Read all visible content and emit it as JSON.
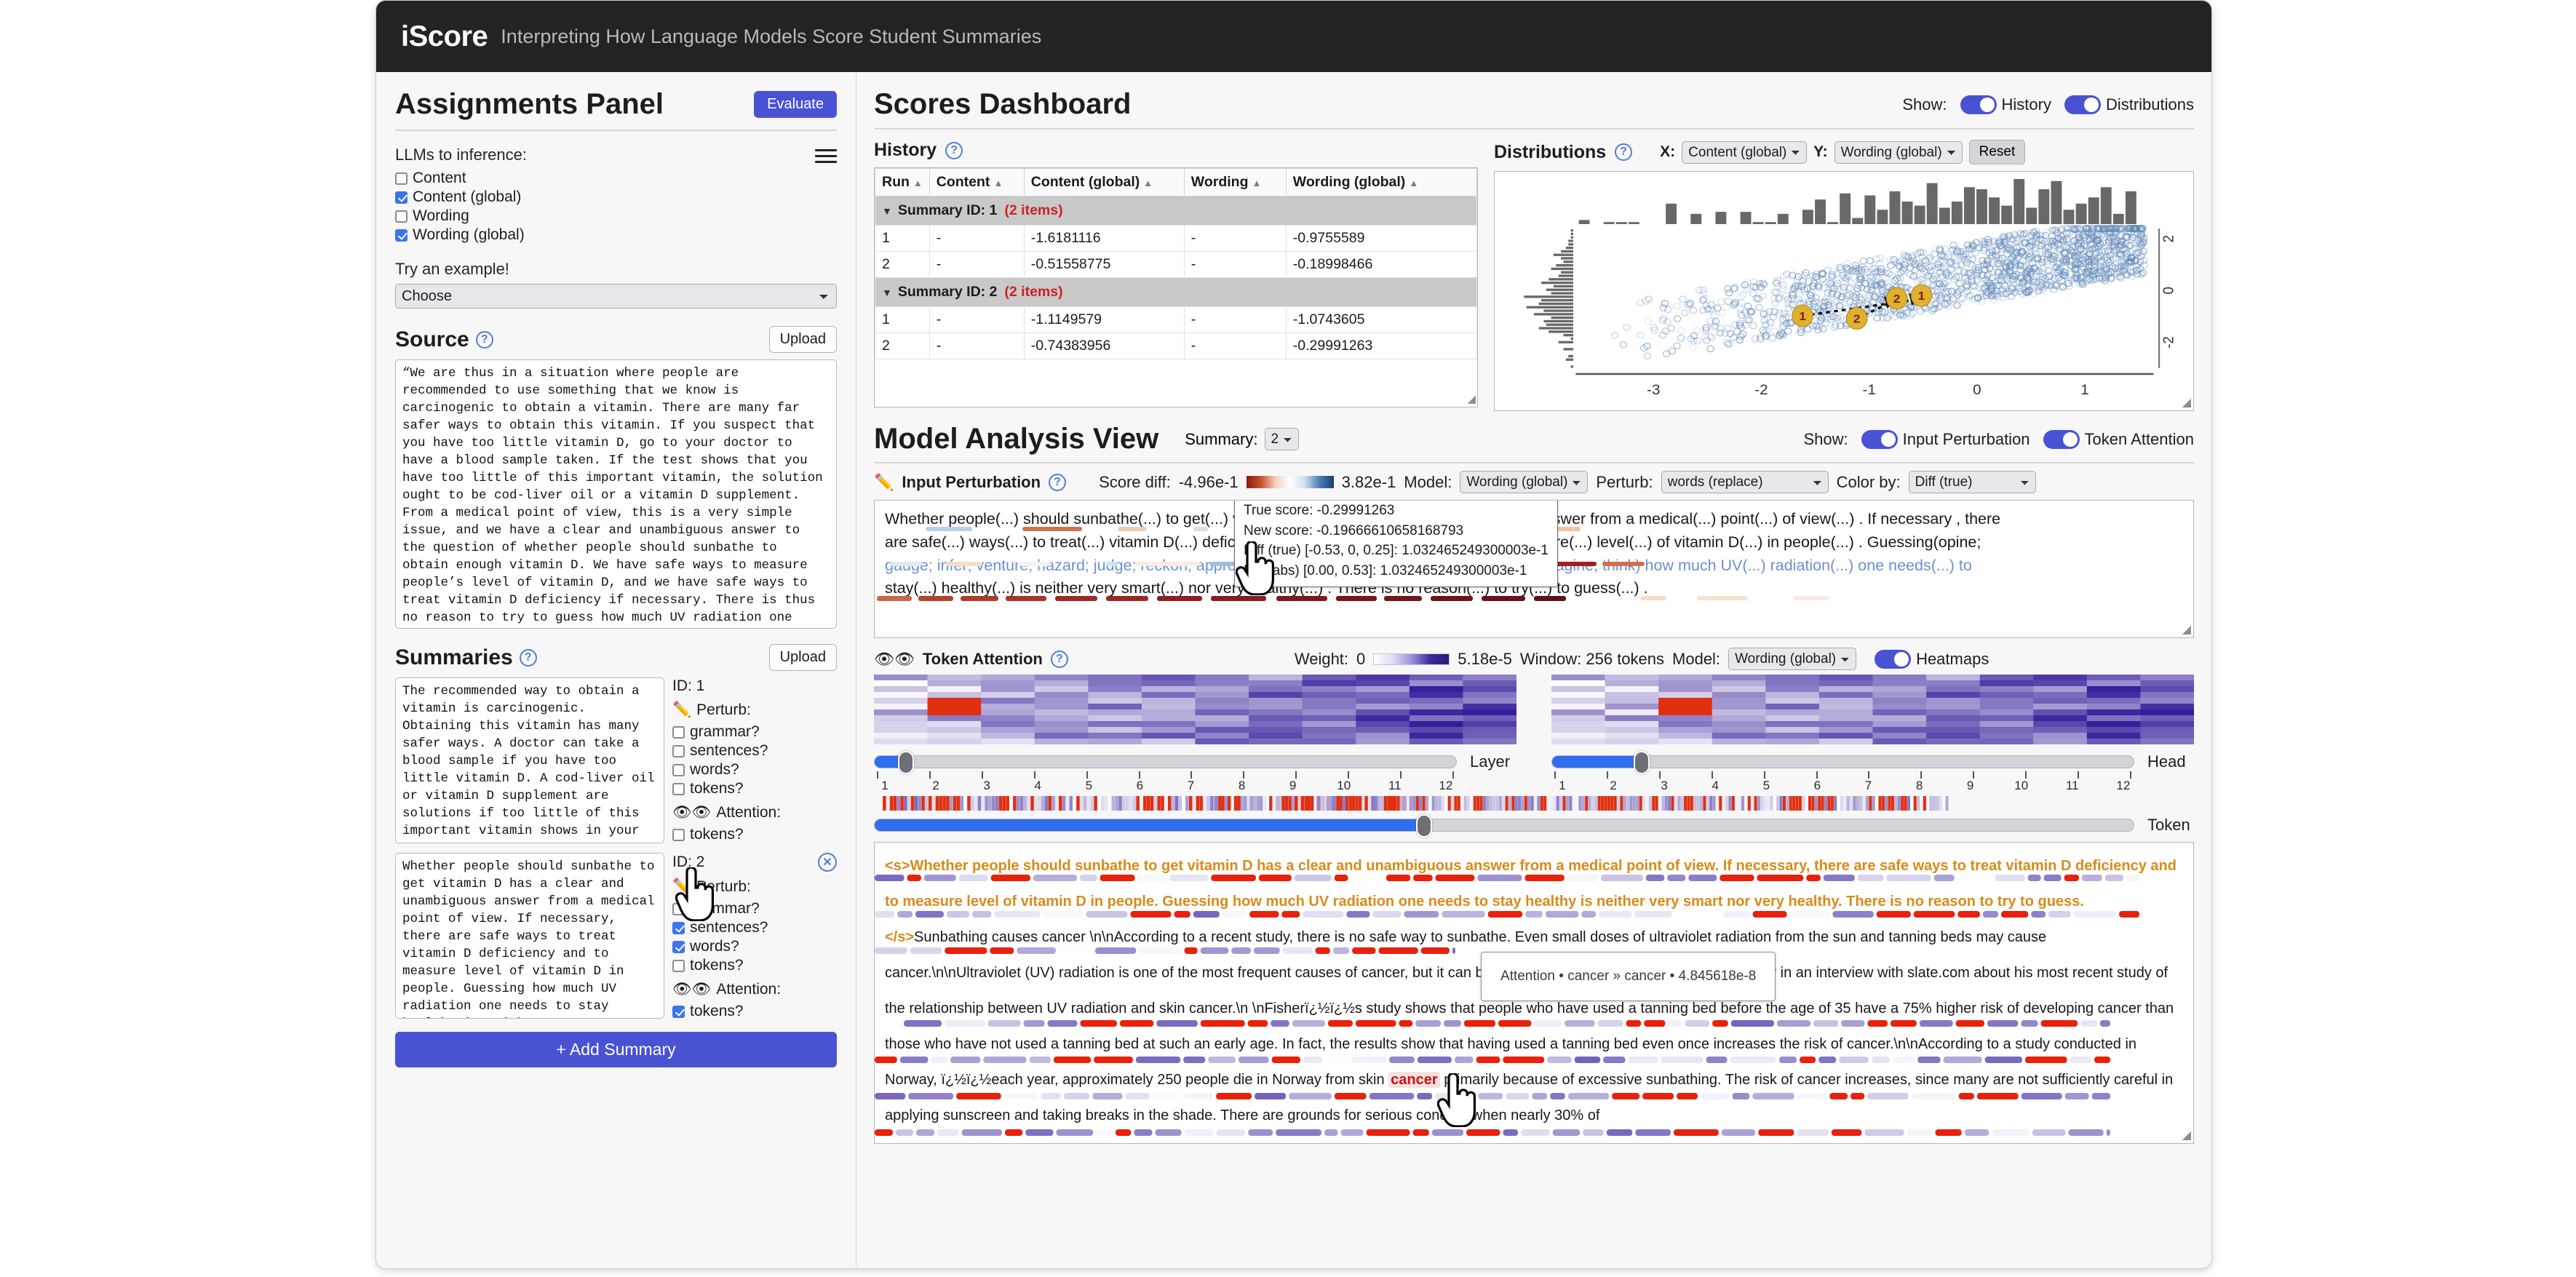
{
  "app": {
    "brand": "iScore",
    "subtitle": "Interpreting How Language Models Score Student Summaries"
  },
  "assignments": {
    "title": "Assignments Panel",
    "evaluate_label": "Evaluate",
    "llms_label": "LLMs to inference:",
    "llm_options": [
      {
        "label": "Content",
        "checked": false
      },
      {
        "label": "Content (global)",
        "checked": true
      },
      {
        "label": "Wording",
        "checked": false
      },
      {
        "label": "Wording (global)",
        "checked": true
      }
    ],
    "example_label": "Try an example!",
    "example_value": "Choose",
    "source": {
      "title": "Source",
      "upload_label": "Upload",
      "text": "“We are thus in a situation where people are recommended to use something that we know is carcinogenic to obtain a vitamin. There are many far safer ways to obtain this vitamin. If you suspect that you have too little vitamin D, go to your doctor to have a blood sample taken. If the test shows that you have too little of this important vitamin, the solution ought to be cod-liver oil or a vitamin D supplement. From a medical point of view, this is a very simple issue, and we have a clear and unambiguous answer to the question of whether people should sunbathe to obtain enough vitamin D. We have safe ways to measure people’s level of vitamin D, and we have safe ways to treat vitamin D deficiency if necessary. There is thus no reason to try to guess how much UV radiation one needs to stay healthy. This is neither very smart, nor very healthy,” Fisher says."
    },
    "summaries": {
      "title": "Summaries",
      "upload_label": "Upload",
      "add_label": "+ Add Summary",
      "perturb_label": "Perturb:",
      "attention_label": "Attention:",
      "items": [
        {
          "id_label": "ID: 1",
          "text": "The recommended way to obtain a vitamin is carcinogenic. Obtaining this vitamin has many safer ways. A doctor can take a blood sample if you have too little vitamin D. A cod-liver oil or vitamin D supplement are solutions if too little of this important vitamin shows in your test.",
          "perturb": [
            {
              "label": "grammar?",
              "checked": false
            },
            {
              "label": "sentences?",
              "checked": false
            },
            {
              "label": "words?",
              "checked": false
            },
            {
              "label": "tokens?",
              "checked": false
            }
          ],
          "attention": [
            {
              "label": "tokens?",
              "checked": false
            }
          ]
        },
        {
          "id_label": "ID: 2",
          "text": "Whether people should sunbathe to get vitamin D has a clear and unambiguous answer from a medical point of view. If necessary, there are safe ways to treat vitamin D deficiency and to measure level of vitamin D in people. Guessing how much UV radiation one needs to stay healthy is neither very smart nor very healthy. There is no reason to try to guess.",
          "perturb": [
            {
              "label": "grammar?",
              "checked": false
            },
            {
              "label": "sentences?",
              "checked": true
            },
            {
              "label": "words?",
              "checked": true
            },
            {
              "label": "tokens?",
              "checked": false
            }
          ],
          "attention": [
            {
              "label": "tokens?",
              "checked": true
            }
          ]
        }
      ]
    }
  },
  "dashboard": {
    "title": "Scores Dashboard",
    "show_label": "Show:",
    "toggles": [
      {
        "label": "History",
        "on": true
      },
      {
        "label": "Distributions",
        "on": true
      }
    ],
    "history": {
      "title": "History",
      "columns": [
        "Run",
        "Content",
        "Content (global)",
        "Wording",
        "Wording (global)"
      ],
      "groups": [
        {
          "label": "Summary ID: 1",
          "count": "(2 items)",
          "rows": [
            {
              "run": "1",
              "content": "-",
              "content_global": "-1.6181116",
              "wording": "-",
              "wording_global": "-0.9755589"
            },
            {
              "run": "2",
              "content": "-",
              "content_global": "-0.51558775",
              "wording": "-",
              "wording_global": "-0.18998466"
            }
          ]
        },
        {
          "label": "Summary ID: 2",
          "count": "(2 items)",
          "rows": [
            {
              "run": "1",
              "content": "-",
              "content_global": "-1.1149579",
              "wording": "-",
              "wording_global": "-1.0743605"
            },
            {
              "run": "2",
              "content": "-",
              "content_global": "-0.74383956",
              "wording": "-",
              "wording_global": "-0.29991263"
            }
          ]
        }
      ]
    },
    "distributions": {
      "title": "Distributions",
      "x_label": "X:",
      "x_value": "Content (global)",
      "y_label": "Y:",
      "y_value": "Wording (global)",
      "reset_label": "Reset"
    }
  },
  "chart_data": {
    "type": "scatter",
    "title": "Distributions",
    "xlabel": "Content (global)",
    "ylabel": "Wording (global)",
    "xlim": [
      -3.7,
      1.6
    ],
    "ylim": [
      -3.0,
      2.4
    ],
    "xticks": [
      -3,
      -2,
      -1,
      0,
      1
    ],
    "yticks": [
      -2,
      0,
      2
    ],
    "grid": false,
    "legend": "none",
    "marginal_top_hist": {
      "bins": 46,
      "counts": [
        2,
        0,
        1,
        1,
        1,
        0,
        0,
        10,
        0,
        5,
        0,
        6,
        0,
        6,
        1,
        1,
        5,
        0,
        7,
        12,
        1,
        15,
        3,
        14,
        7,
        16,
        11,
        9,
        20,
        8,
        11,
        18,
        17,
        13,
        9,
        22,
        8,
        17,
        21,
        7,
        10,
        13,
        18,
        5,
        16,
        0
      ]
    },
    "marginal_right_hist": {
      "bins": 40,
      "counts": [
        1,
        0,
        3,
        2,
        0,
        4,
        0,
        6,
        1,
        4,
        10,
        14,
        11,
        12,
        9,
        16,
        12,
        19,
        14,
        13,
        20,
        9,
        11,
        8,
        13,
        10,
        6,
        5,
        9,
        7,
        4,
        5,
        8,
        5,
        3,
        2,
        2,
        1,
        1,
        1
      ]
    },
    "highlight_points": [
      {
        "label": "1",
        "x": -1.6181116,
        "y": -0.9755589,
        "color": "#e0b030"
      },
      {
        "label": "1",
        "x": -0.51558775,
        "y": -0.18998466,
        "color": "#e0b030"
      },
      {
        "label": "2",
        "x": -1.1149579,
        "y": -1.0743605,
        "color": "#e0b030"
      },
      {
        "label": "2",
        "x": -0.74383956,
        "y": -0.29991263,
        "color": "#e0b030"
      }
    ],
    "arrows": [
      {
        "from": [
          -1.6181116,
          -0.9755589
        ],
        "to": [
          -0.51558775,
          -0.18998466
        ],
        "label": "1"
      },
      {
        "from": [
          -1.1149579,
          -1.0743605
        ],
        "to": [
          -0.74383956,
          -0.29991263
        ],
        "label": "2"
      }
    ],
    "scatter_color": "#5b86b8"
  },
  "model_analysis": {
    "title": "Model Analysis View",
    "summary_label": "Summary:",
    "summary_value": "2",
    "show_label": "Show:",
    "toggles": [
      {
        "label": "Input Perturbation",
        "on": true
      },
      {
        "label": "Token Attention",
        "on": true
      }
    ],
    "input_perturbation": {
      "title": "Input Perturbation",
      "score_diff_label": "Score diff:",
      "score_diff_min": "-4.96e-1",
      "score_diff_max": "3.82e-1",
      "model_label": "Model:",
      "model_value": "Wording (global)",
      "perturb_label": "Perturb:",
      "perturb_value": "words (replace)",
      "colorby_label": "Color by:",
      "colorby_value": "Diff (true)",
      "line1": "Whether people(...) should sunbathe(...) to get(...) vitamin D(...) has a clear and unambiguous answer from a medical(...) point(...) of view(...) . If necessary , there",
      "line2": "are safe(...) ways(...) to treat(...) vitamin D(...) deficiency(inadequacy; insufficiency) and to measure(...) level(...) of vitamin D(...) in people(...) . Guessing(opine;",
      "line3": "gauge; infer; venture; hazard; judge; reckon; approximate; estimate; pretend; guess; suppose; imagine; think) how much UV(...) radiation(...) one needs(...) to",
      "line4": "stay(...) healthy(...) is neither very smart(...) nor very healthy(...) . There is no reason(...) to try(...) to guess(...) .",
      "tooltip": {
        "true_score": "True score: -0.29991263",
        "new_score": "New score: -0.19666610658168793",
        "diff_true": "Diff (true) [-0.53, 0, 0.25]: 1.032465249300003e-1",
        "diff_abs": "Diff (abs) [0.00, 0.53]: 1.032465249300003e-1"
      }
    },
    "token_attention": {
      "title": "Token Attention",
      "weight_label": "Weight:",
      "weight_min": "0",
      "weight_max": "5.18e-5",
      "window_label": "Window: 256 tokens",
      "model_label": "Model:",
      "model_value": "Wording (global)",
      "heatmaps_label": "Heatmaps",
      "layer_label": "Layer",
      "layer_value": 2,
      "head_label": "Head",
      "head_value": 3,
      "token_label": "Token",
      "tick_labels": [
        "1",
        "2",
        "3",
        "4",
        "5",
        "6",
        "7",
        "8",
        "9",
        "10",
        "11",
        "12"
      ],
      "summary_text": "<s>Whether people should sunbathe to get vitamin D has a clear and unambiguous answer from a medical point of view. If necessary, there are safe ways to treat vitamin D deficiency and to measure level of vitamin D in people. Guessing how much UV radiation one needs to stay healthy is neither very smart nor very healthy. There is no reason to try to guess.</s>",
      "source_text_1": "Sunbathing causes cancer \\n\\nAccording to a recent study, there is no safe way to sunbathe.",
      "source_text_2": "Even small doses of ultraviolet radiation from the sun and tanning beds may cause cancer.\\n\\nUltraviolet (UV) radiation is one of the most frequent causes of cancer, but",
      "source_text_3": "it can be avoided. So says Professor David E. Fisher in an interview with slate.com about his most recent study of the relationship between UV radiation and skin cancer.\\n",
      "source_text_4": "\\nFisherï¿½ï¿½s study shows that people who have used a tanning bed before the age of 35 have a 75% higher risk of developing cancer than those who have",
      "source_text_5": "not used a tanning bed at such an early age. In fact, the results show that having used a tanning bed even once increases the risk of cancer.\\n\\nAccording to a",
      "source_text_6a": "study conducted in Norway, ï¿½ï¿½each year, approximately 250 people die in Norway from skin ",
      "source_text_6b": "cancer",
      "source_text_6c": " primarily because of excessive sunbathing. The risk of cancer",
      "source_text_7": "increases, since many are not sufficiently careful in applying sunscreen and taking breaks in the shade. There are grounds for serious concern when nearly 30% of",
      "tooltip": "Attention • cancer » cancer • 4.845618e-8"
    }
  },
  "colors": {
    "accent": "#4a52d4",
    "toggle_on": "#4a52d4",
    "header_bg": "#232323",
    "group_row": "#c9c9c9",
    "items_count": "#cc2222",
    "highlight_marker": "#e0b030",
    "attention_heading": "#d98a1a",
    "cancer_highlight": "#d01010"
  }
}
